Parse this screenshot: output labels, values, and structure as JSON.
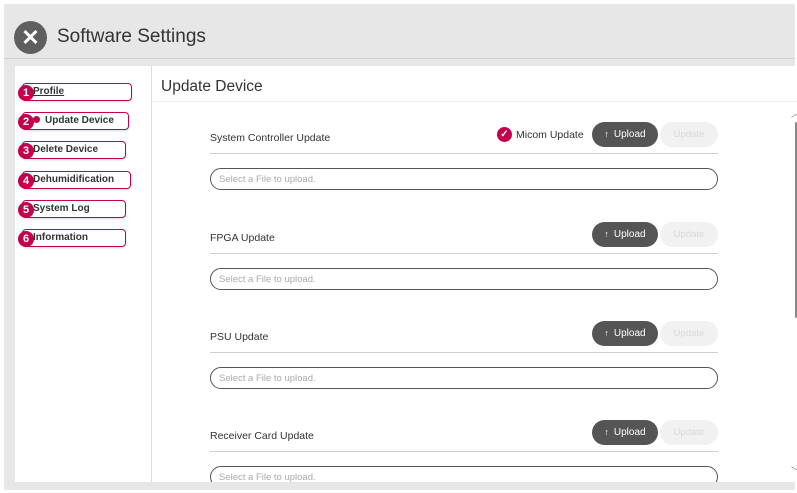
{
  "header": {
    "title": "Software Settings",
    "close_icon": "close-icon"
  },
  "sidebar": {
    "items": [
      {
        "num": "1",
        "label": "Profile"
      },
      {
        "num": "2",
        "label": "Update Device"
      },
      {
        "num": "3",
        "label": "Delete Device"
      },
      {
        "num": "4",
        "label": "Dehumidification"
      },
      {
        "num": "5",
        "label": "System Log"
      },
      {
        "num": "6",
        "label": "Information"
      }
    ]
  },
  "main": {
    "title": "Update Device",
    "micom": {
      "label": "Micom Update",
      "checked": true
    },
    "sections": [
      {
        "label": "System Controller Update",
        "upload": "Upload",
        "update": "Update",
        "placeholder": "Select a File to upload."
      },
      {
        "label": "FPGA Update",
        "upload": "Upload",
        "update": "Update",
        "placeholder": "Select a File to upload."
      },
      {
        "label": "PSU Update",
        "upload": "Upload",
        "update": "Update",
        "placeholder": "Select a File to upload."
      },
      {
        "label": "Receiver Card Update",
        "upload": "Upload",
        "update": "Update",
        "placeholder": "Select a File to upload."
      }
    ]
  },
  "colors": {
    "accent": "#c4004c",
    "upload_button": "#555555",
    "disabled_button": "#f1f1f1"
  }
}
